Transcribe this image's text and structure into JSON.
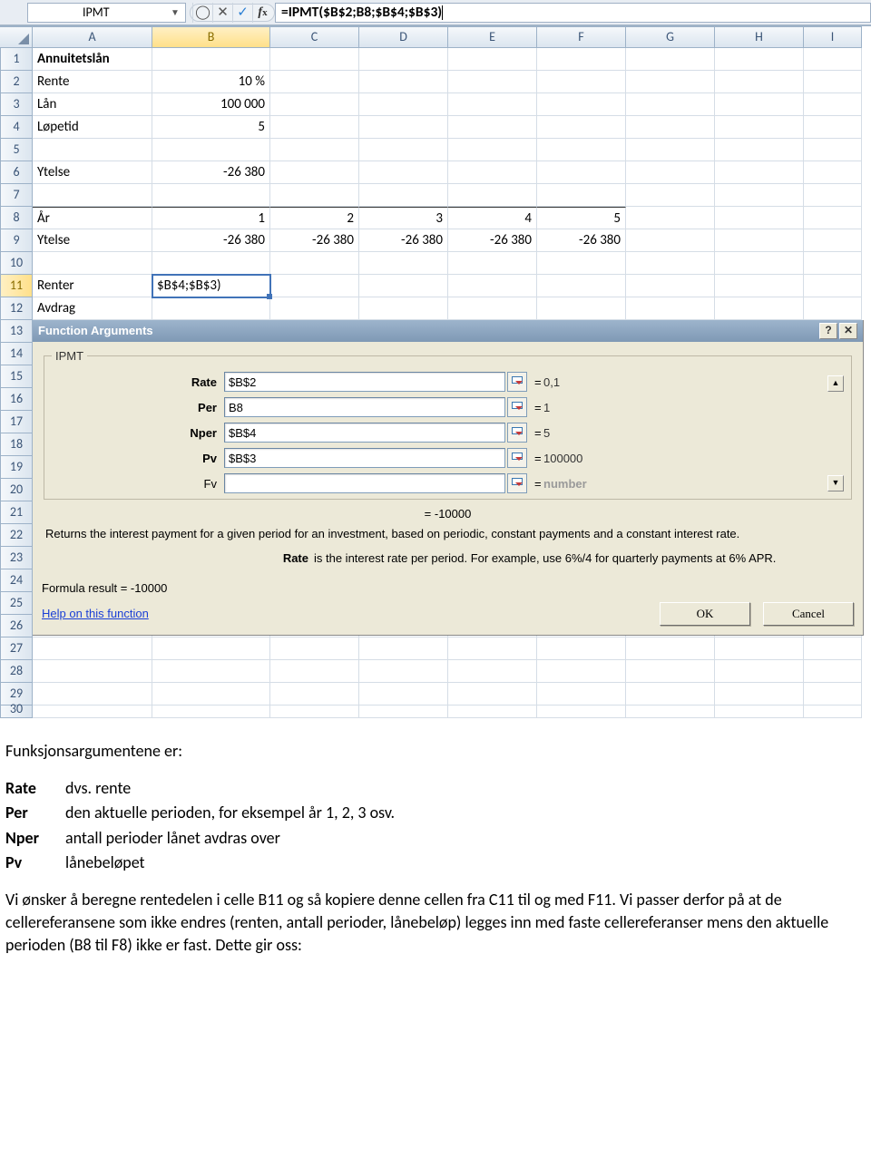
{
  "formula_bar": {
    "name_box": "IPMT",
    "formula": "=IPMT($B$2;B8;$B$4;$B$3)"
  },
  "columns": [
    "A",
    "B",
    "C",
    "D",
    "E",
    "F",
    "G",
    "H",
    "I"
  ],
  "rows": {
    "r1": {
      "A": "Annuitetslån"
    },
    "r2": {
      "A": "Rente",
      "B": "10 %"
    },
    "r3": {
      "A": "Lån",
      "B": "100 000"
    },
    "r4": {
      "A": "Løpetid",
      "B": "5"
    },
    "r6": {
      "A": "Ytelse",
      "B": "-26 380"
    },
    "r8": {
      "A": "År",
      "B": "1",
      "C": "2",
      "D": "3",
      "E": "4",
      "F": "5"
    },
    "r9": {
      "A": "Ytelse",
      "B": "-26 380",
      "C": "-26 380",
      "D": "-26 380",
      "E": "-26 380",
      "F": "-26 380"
    },
    "r11": {
      "A": "Renter",
      "B": "$B$4;$B$3)"
    },
    "r12": {
      "A": "Avdrag"
    }
  },
  "dialog": {
    "title": "Function Arguments",
    "fn_name": "IPMT",
    "args": [
      {
        "label": "Rate",
        "input": "$B$2",
        "value": "0,1"
      },
      {
        "label": "Per",
        "input": "B8",
        "value": "1"
      },
      {
        "label": "Nper",
        "input": "$B$4",
        "value": "5"
      },
      {
        "label": "Pv",
        "input": "$B$3",
        "value": "100000"
      },
      {
        "label": "Fv",
        "input": "",
        "value": "number",
        "gray": true
      }
    ],
    "calc_eq": "=  -10000",
    "description": "Returns the interest payment for a given period for an investment, based on periodic, constant payments and a constant interest rate.",
    "hint_label": "Rate",
    "hint_text": "is the interest rate per period. For example, use 6%/4 for quarterly payments at 6% APR.",
    "formula_result_label": "Formula result =",
    "formula_result_value": " -10000",
    "help_link": "Help on this function",
    "ok": "OK",
    "cancel": "Cancel"
  },
  "doc": {
    "intro": "Funksjonsargumentene er:",
    "defs": [
      {
        "k": "Rate",
        "v": "dvs. rente"
      },
      {
        "k": "Per",
        "v": "den aktuelle perioden, for eksempel år 1, 2, 3 osv."
      },
      {
        "k": "Nper",
        "v": "antall perioder lånet avdras over"
      },
      {
        "k": "Pv",
        "v": "lånebeløpet"
      }
    ],
    "para": "Vi ønsker å beregne rentedelen i celle B11 og så kopiere denne cellen fra C11 til og med F11. Vi passer derfor på at de cellereferansene som ikke endres (renten, antall perioder, lånebeløp) legges inn med faste cellereferanser mens den aktuelle perioden (B8 til F8) ikke er fast. Dette gir oss:"
  }
}
